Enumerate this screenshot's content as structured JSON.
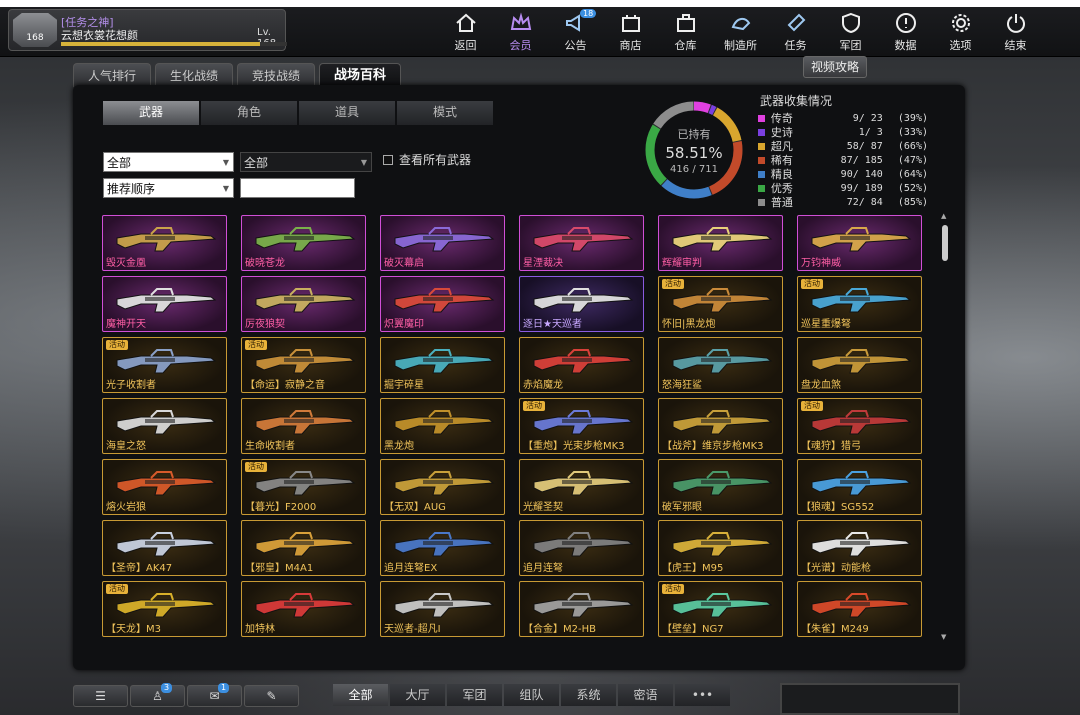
{
  "player": {
    "rank_level": "168",
    "tag": "[任务之神]",
    "name": "云想衣裳花想颜",
    "level": "Lv. 168",
    "xp_fraction": 0.88
  },
  "nav": [
    {
      "label": "返回",
      "icon": "home-icon"
    },
    {
      "label": "会员",
      "icon": "crown-icon",
      "active": true
    },
    {
      "label": "公告",
      "icon": "megaphone-icon",
      "badge": "18"
    },
    {
      "label": "商店",
      "icon": "shop-icon"
    },
    {
      "label": "仓库",
      "icon": "warehouse-icon"
    },
    {
      "label": "制造所",
      "icon": "factory-icon"
    },
    {
      "label": "任务",
      "icon": "task-icon"
    },
    {
      "label": "军团",
      "icon": "shield-icon"
    },
    {
      "label": "数据",
      "icon": "info-icon"
    },
    {
      "label": "选项",
      "icon": "gear-icon"
    },
    {
      "label": "结束",
      "icon": "power-icon"
    }
  ],
  "tabs": [
    {
      "label": "人气排行"
    },
    {
      "label": "生化战绩"
    },
    {
      "label": "竞技战绩"
    },
    {
      "label": "战场百科",
      "active": true
    }
  ],
  "guide_button": "视频攻略",
  "subtabs": [
    {
      "label": "武器",
      "active": true
    },
    {
      "label": "角色"
    },
    {
      "label": "道具"
    },
    {
      "label": "模式"
    }
  ],
  "filters": {
    "category": "全部",
    "sub_category": "全部",
    "sort": "推荐顺序",
    "search_value": "",
    "show_all_label": "查看所有武器"
  },
  "donut": {
    "label": "已持有",
    "percent": "58.51%",
    "count": "416 / 711"
  },
  "collection": {
    "title": "武器收集情况",
    "rows": [
      {
        "name": "传奇",
        "count": "9/  23",
        "pct": "(39%)",
        "color": "#e040e0"
      },
      {
        "name": "史诗",
        "count": "1/   3",
        "pct": "(33%)",
        "color": "#7a3fe0"
      },
      {
        "name": "超凡",
        "count": "58/  87",
        "pct": "(66%)",
        "color": "#d9a62e"
      },
      {
        "name": "稀有",
        "count": "87/ 185",
        "pct": "(47%)",
        "color": "#c24a2a"
      },
      {
        "name": "精良",
        "count": "90/ 140",
        "pct": "(64%)",
        "color": "#3f7fc8"
      },
      {
        "name": "优秀",
        "count": "99/ 189",
        "pct": "(52%)",
        "color": "#3aa845"
      },
      {
        "name": "普通",
        "count": "72/  84",
        "pct": "(85%)",
        "color": "#8d8d8d"
      }
    ]
  },
  "event_label": "活动",
  "weapons": [
    {
      "name": "毁灭金凰",
      "rarity": "legend",
      "color": "#c9a34a"
    },
    {
      "name": "破晓苍龙",
      "rarity": "legend",
      "color": "#7ab04a"
    },
    {
      "name": "破灭幕启",
      "rarity": "legend",
      "color": "#8a6ad8"
    },
    {
      "name": "星湮裁决",
      "rarity": "legend",
      "color": "#d84a6a"
    },
    {
      "name": "辉耀审判",
      "rarity": "legend",
      "color": "#e8d27a"
    },
    {
      "name": "万钧神威",
      "rarity": "legend",
      "color": "#d8a84a"
    },
    {
      "name": "魔神开天",
      "rarity": "legend",
      "color": "#e0e0e0"
    },
    {
      "name": "厉夜狼契",
      "rarity": "legend",
      "color": "#c8b060"
    },
    {
      "name": "炽翼魔印",
      "rarity": "legend",
      "color": "#d84a3a"
    },
    {
      "name": "逐日★天巡者",
      "rarity": "epic",
      "color": "#e0e0e0"
    },
    {
      "name": "怀旧|黑龙炮",
      "rarity": "gold",
      "event": true,
      "color": "#c98a3a"
    },
    {
      "name": "巡星重爆弩",
      "rarity": "gold",
      "event": true,
      "color": "#4aa8d8"
    },
    {
      "name": "光子收割者",
      "rarity": "gold",
      "event": true,
      "color": "#8aa0c8"
    },
    {
      "name": "【命运】寂静之音",
      "rarity": "gold",
      "event": true,
      "color": "#c8903a"
    },
    {
      "name": "掘宇碎星",
      "rarity": "gold",
      "color": "#4ab0c0"
    },
    {
      "name": "赤焰魔龙",
      "rarity": "gold",
      "color": "#d8403a"
    },
    {
      "name": "怒海狂鲨",
      "rarity": "gold",
      "color": "#5aa0a8"
    },
    {
      "name": "盘龙血煞",
      "rarity": "gold",
      "color": "#c89a3a"
    },
    {
      "name": "海皇之怒",
      "rarity": "gold",
      "color": "#d8d8d8"
    },
    {
      "name": "生命收割者",
      "rarity": "gold",
      "color": "#d07a3a"
    },
    {
      "name": "黑龙炮",
      "rarity": "gold",
      "color": "#c0902a"
    },
    {
      "name": "【重炮】光束步枪MK3",
      "rarity": "gold",
      "event": true,
      "color": "#6a7ad8"
    },
    {
      "name": "【战斧】维京步枪MK3",
      "rarity": "gold",
      "color": "#c8a03a"
    },
    {
      "name": "【魂狩】猎弓",
      "rarity": "gold",
      "event": true,
      "color": "#c03a3a"
    },
    {
      "name": "熔火岩狼",
      "rarity": "gold",
      "color": "#d85a2a"
    },
    {
      "name": "【暮光】F2000",
      "rarity": "gold",
      "event": true,
      "color": "#888888"
    },
    {
      "name": "【无双】AUG",
      "rarity": "gold",
      "color": "#c8a03a"
    },
    {
      "name": "光耀圣契",
      "rarity": "gold",
      "color": "#e0c87a"
    },
    {
      "name": "破军邪眼",
      "rarity": "gold",
      "color": "#4a9a6a"
    },
    {
      "name": "【狼魂】SG552",
      "rarity": "gold",
      "color": "#4aa0e0"
    },
    {
      "name": "【圣帝】AK47",
      "rarity": "gold",
      "color": "#c8d0e0"
    },
    {
      "name": "【邪皇】M4A1",
      "rarity": "gold",
      "color": "#d8a03a"
    },
    {
      "name": "追月连弩EX",
      "rarity": "gold",
      "color": "#4a78c8"
    },
    {
      "name": "追月连弩",
      "rarity": "gold",
      "color": "#808080"
    },
    {
      "name": "【虎王】M95",
      "rarity": "gold",
      "color": "#d8b03a"
    },
    {
      "name": "【光谱】动能枪",
      "rarity": "gold",
      "color": "#e8e8e8"
    },
    {
      "name": "【天龙】M3",
      "rarity": "gold",
      "event": true,
      "color": "#d8b02a"
    },
    {
      "name": "加特林",
      "rarity": "gold",
      "color": "#d83a3a"
    },
    {
      "name": "天巡者-超凡Ⅰ",
      "rarity": "gold",
      "color": "#c8c8c8"
    },
    {
      "name": "【合金】M2-HB",
      "rarity": "gold",
      "color": "#a0a0a0"
    },
    {
      "name": "【壁垒】NG7",
      "rarity": "gold",
      "event": true,
      "color": "#5ac8a0"
    },
    {
      "name": "【朱雀】M249",
      "rarity": "gold",
      "color": "#d84a2a"
    }
  ],
  "bottom_buttons": [
    {
      "icon": "list-icon"
    },
    {
      "icon": "friends-icon",
      "badge": "3"
    },
    {
      "icon": "group-chat-icon",
      "badge": "1"
    },
    {
      "icon": "edit-icon"
    }
  ],
  "chat_tabs": [
    {
      "label": "全部",
      "active": true
    },
    {
      "label": "大厅"
    },
    {
      "label": "军团"
    },
    {
      "label": "组队"
    },
    {
      "label": "系统"
    },
    {
      "label": "密语"
    },
    {
      "label": "•••"
    }
  ]
}
